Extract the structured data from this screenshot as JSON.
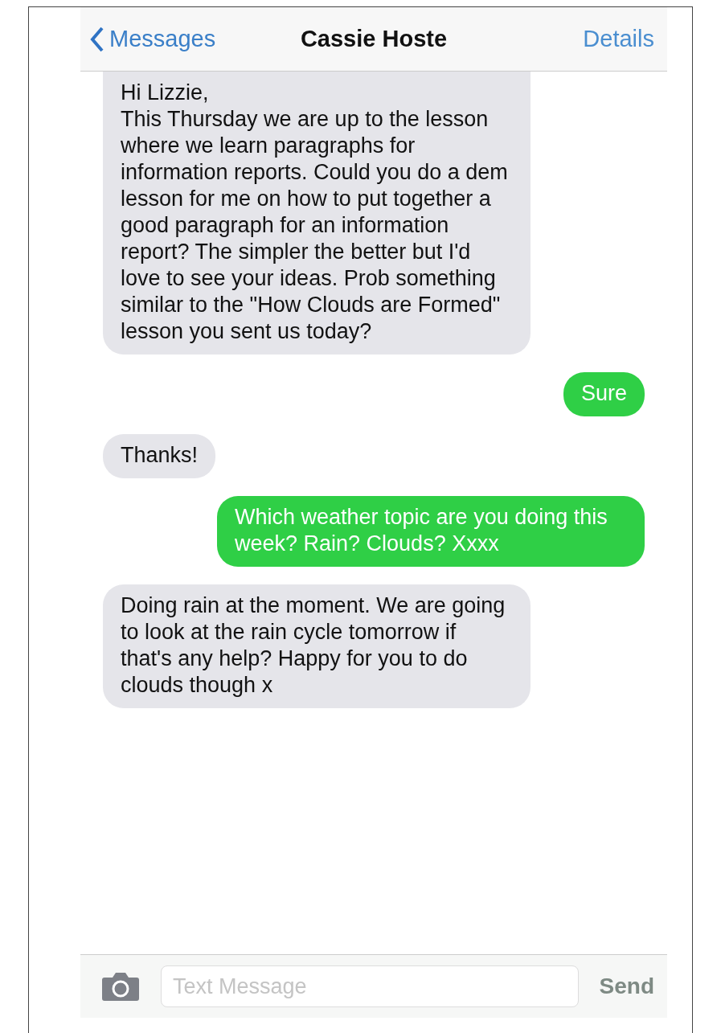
{
  "header": {
    "back": "Messages",
    "title": "Cassie Hoste",
    "action": "Details"
  },
  "messages": [
    {
      "kind": "incoming",
      "text": "Hi Lizzie,\nThis Thursday we are up to the lesson where we learn paragraphs for information reports. Could you do a dem lesson for me on how to put together a good paragraph for an information report? The simpler the better but I'd love to see your ideas. Prob something similar to the \"How Clouds are Formed\" lesson you sent us today?"
    },
    {
      "kind": "outgoing",
      "text": "Sure"
    },
    {
      "kind": "incoming",
      "text": "Thanks!"
    },
    {
      "kind": "outgoing",
      "text": "Which weather topic are you doing this week? Rain? Clouds? Xxxx"
    },
    {
      "kind": "incoming",
      "text": "Doing rain at the moment. We are going to look at the rain cycle tomorrow if that's any help? Happy for you to do clouds though x"
    }
  ],
  "composer": {
    "placeholder": "Text Message",
    "send": "Send"
  }
}
